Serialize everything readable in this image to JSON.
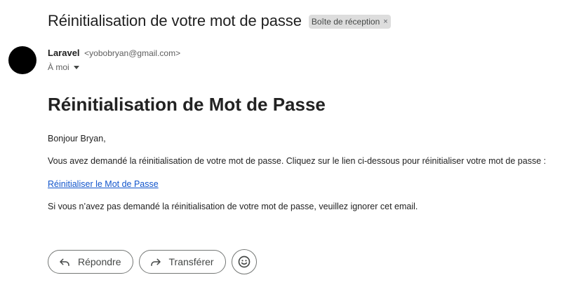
{
  "email": {
    "subject": "Réinitialisation de votre mot de passe",
    "label": "Boîte de réception",
    "label_close": "×",
    "sender_name": "Laravel",
    "sender_email": "<yobobryan@gmail.com>",
    "recipient": "À moi"
  },
  "body": {
    "heading": "Réinitialisation de Mot de Passe",
    "greeting": "Bonjour Bryan,",
    "intro": "Vous avez demandé la réinitialisation de votre mot de passe. Cliquez sur le lien ci-dessous pour réinitialiser votre mot de passe :",
    "link": "Réinitialiser le Mot de Passe",
    "outro": "Si vous n’avez pas demandé la réinitialisation de votre mot de passe, veuillez ignorer cet email."
  },
  "actions": {
    "reply": "Répondre",
    "forward": "Transférer"
  },
  "icons": {
    "reply": "reply-icon",
    "forward": "forward-icon",
    "emoji": "emoji-smile-icon",
    "caret": "caret-down-icon"
  },
  "colors": {
    "link": "#1155cc",
    "avatar": "#000000",
    "chip_bg": "#dddddd"
  }
}
